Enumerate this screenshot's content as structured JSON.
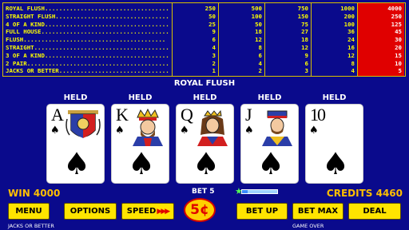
{
  "paytable": {
    "hands": [
      "ROYAL FLUSH",
      "STRAIGHT FLUSH",
      "4 OF A KIND",
      "FULL HOUSE",
      "FLUSH",
      "STRAIGHT",
      "3 OF A KIND",
      "2 PAIR",
      "JACKS OR BETTER"
    ],
    "columns": [
      [
        "250",
        "50",
        "25",
        "9",
        "6",
        "4",
        "3",
        "2",
        "1"
      ],
      [
        "500",
        "100",
        "50",
        "18",
        "12",
        "8",
        "6",
        "4",
        "2"
      ],
      [
        "750",
        "150",
        "75",
        "27",
        "18",
        "12",
        "9",
        "6",
        "3"
      ],
      [
        "1000",
        "200",
        "100",
        "36",
        "24",
        "16",
        "12",
        "8",
        "4"
      ],
      [
        "4000",
        "250",
        "125",
        "45",
        "30",
        "20",
        "15",
        "10",
        "5"
      ]
    ],
    "highlight_column_index": 4,
    "highlight_color": "#e00000",
    "text_color": "#ffff00",
    "border_color": "#d8c000"
  },
  "result_title": "ROYAL FLUSH",
  "cards": [
    {
      "held": "HELD",
      "rank": "A",
      "suit": "spades"
    },
    {
      "held": "HELD",
      "rank": "K",
      "suit": "spades"
    },
    {
      "held": "HELD",
      "rank": "Q",
      "suit": "spades"
    },
    {
      "held": "HELD",
      "rank": "J",
      "suit": "spades"
    },
    {
      "held": "HELD",
      "rank": "10",
      "suit": "spades"
    }
  ],
  "win_label": "WIN 4000",
  "bet_label": "BET 5",
  "credits_label": "CREDITS 4460",
  "denomination": "5¢",
  "progress_fraction": 0.15,
  "buttons": {
    "menu": "MENU",
    "options": "OPTIONS",
    "speed": "SPEED",
    "bet_up": "BET UP",
    "bet_max": "BET MAX",
    "deal": "DEAL"
  },
  "footer": {
    "left": "JACKS OR BETTER",
    "right": "GAME OVER"
  },
  "colors": {
    "background": "#0a0a8c",
    "button": "#ffe400",
    "win_credits": "#ffbf00"
  }
}
